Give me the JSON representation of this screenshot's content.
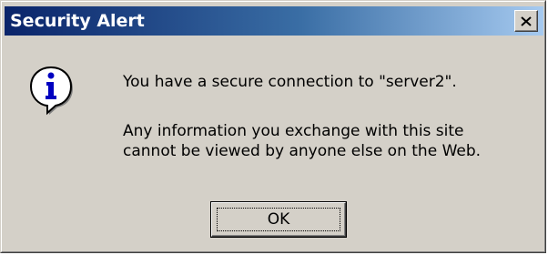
{
  "dialog": {
    "title": "Security Alert",
    "icon": "info-icon",
    "message_line1": "You have a secure connection to \"server2\".",
    "message_line2a": "Any information you exchange with this site",
    "message_line2b": "cannot be viewed by anyone else on the Web.",
    "ok_label": "OK",
    "colors": {
      "titlebar_start": "#0a246a",
      "titlebar_end": "#a6caf0",
      "face": "#d4d0c8"
    }
  }
}
